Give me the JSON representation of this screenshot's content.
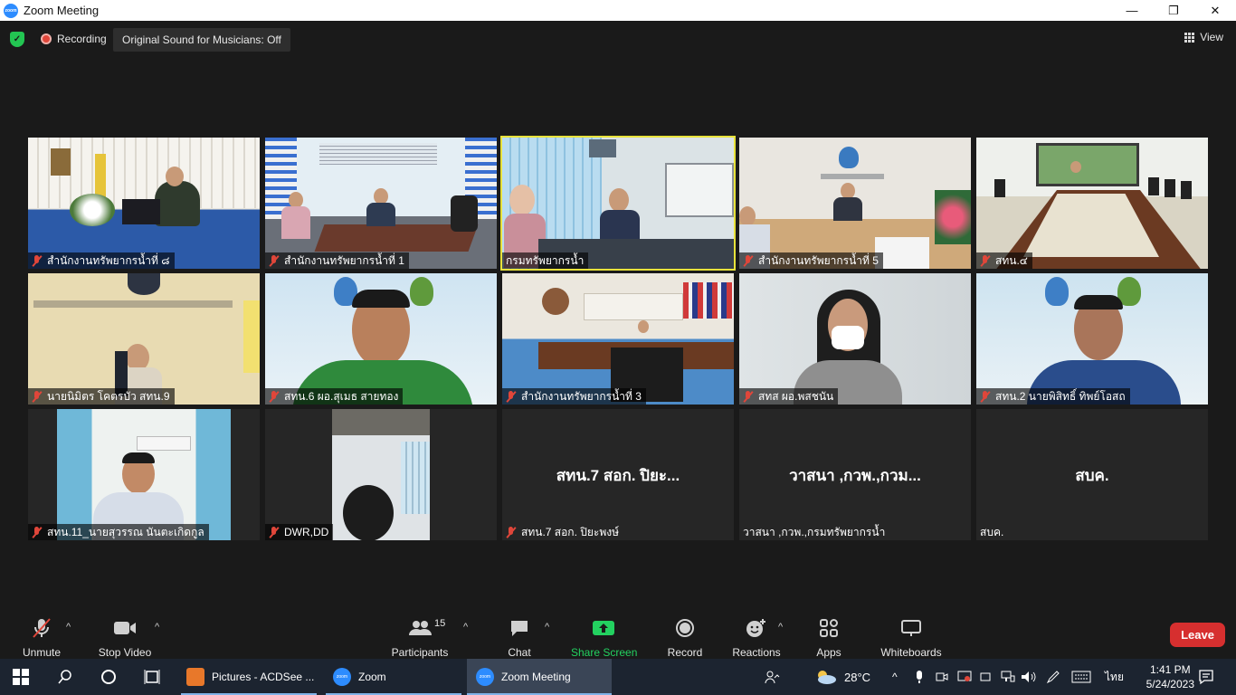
{
  "window": {
    "title": "Zoom Meeting",
    "minimize": "—",
    "maximize": "❐",
    "close": "✕"
  },
  "meeting_bar": {
    "recording_label": "Recording",
    "original_sound": "Original Sound for Musicians: Off",
    "view_label": "View"
  },
  "tiles": [
    {
      "name": "สำนักงานทรัพยากรน้ำที่ ๘",
      "muted": true
    },
    {
      "name": "สำนักงานทรัพยากรน้ำที่ 1",
      "muted": true
    },
    {
      "name": "กรมทรัพยากรน้ำ",
      "muted": false,
      "active": true
    },
    {
      "name": "สำนักงานทรัพยากรน้ำที่ 5",
      "muted": true
    },
    {
      "name": "สทน.๔",
      "muted": true
    },
    {
      "name": "นายนิมิตร โคตรบัว สทน.9",
      "muted": true
    },
    {
      "name": "สทน.6 ผอ.สุเมธ สายทอง",
      "muted": true
    },
    {
      "name": "สำนักงานทรัพยากรน้ำที่ 3",
      "muted": true
    },
    {
      "name": "สทส  ผอ.พสชนัน",
      "muted": true
    },
    {
      "name": "สทน.2 นายพิสิทธิ์ ทิพย์โอสถ",
      "muted": true
    },
    {
      "name": "สทน.11_นายสุวรรณ  นันตะเกิดกูล",
      "muted": true
    },
    {
      "name": "DWR,DD",
      "muted": true
    },
    {
      "name": "สทน.7 สอก. ปิยะพงษ์",
      "display": "สทน.7 สอก. ปิยะ...",
      "muted": true
    },
    {
      "name": "วาสนา ,กวพ.,กรมทรัพยากรน้ำ",
      "display": "วาสนา ,กวพ.,กวม...",
      "muted": false
    },
    {
      "name": "สบค.",
      "display": "สบค.",
      "muted": false
    }
  ],
  "toolbar": {
    "unmute": "Unmute",
    "stop_video": "Stop Video",
    "participants": "Participants",
    "participants_count": "15",
    "chat": "Chat",
    "share_screen": "Share Screen",
    "record": "Record",
    "reactions": "Reactions",
    "apps": "Apps",
    "whiteboards": "Whiteboards",
    "leave": "Leave"
  },
  "taskbar": {
    "items": [
      "Pictures - ACDSee ...",
      "Zoom",
      "Zoom Meeting"
    ],
    "weather": "28°C",
    "language": "ไทย",
    "time": "1:41 PM",
    "date": "5/24/2023"
  },
  "colors": {
    "accent_green": "#23d160",
    "leave_red": "#d62f2f",
    "active_speaker": "#e8e23b",
    "muted_red": "#e0463a"
  }
}
